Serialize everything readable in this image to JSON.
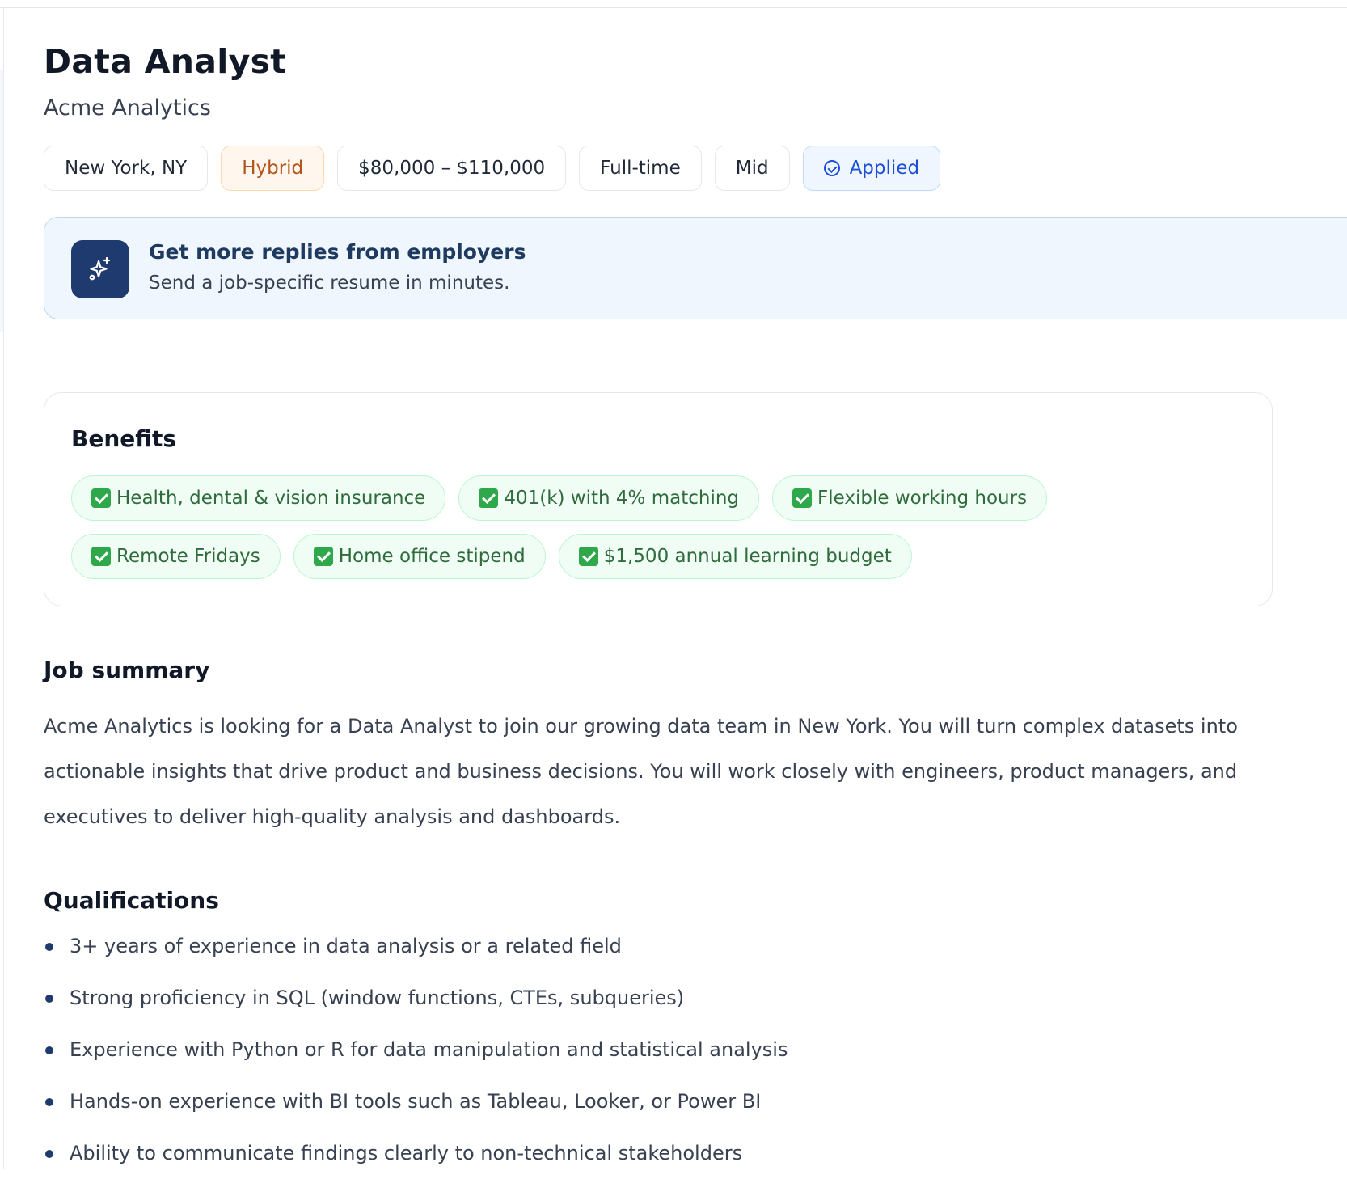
{
  "job": {
    "title": "Data Analyst",
    "company": "Acme Analytics"
  },
  "tags": {
    "location": "New York, NY",
    "work_mode": "Hybrid",
    "salary": "$80,000 – $110,000",
    "employment_type": "Full-time",
    "level": "Mid",
    "status": "Applied"
  },
  "promo": {
    "icon": "sparkles-icon",
    "title": "Get more replies from employers",
    "subtitle": "Send a job-specific resume in minutes."
  },
  "benefits": {
    "title": "Benefits",
    "items": [
      "Health, dental & vision insurance",
      "401(k) with 4% matching",
      "Flexible working hours",
      "Remote Fridays",
      "Home office stipend",
      "$1,500 annual learning budget"
    ]
  },
  "summary": {
    "title": "Job summary",
    "text": "Acme Analytics is looking for a Data Analyst to join our growing data team in New York. You will turn complex datasets into actionable insights that drive product and business decisions. You will work closely with engineers, product managers, and executives to deliver high-quality analysis and dashboards."
  },
  "qualifications": {
    "title": "Qualifications",
    "items": [
      "3+ years of experience in data analysis or a related field",
      "Strong proficiency in SQL (window functions, CTEs, subqueries)",
      "Experience with Python or R for data manipulation and statistical analysis",
      "Hands-on experience with BI tools such as Tableau, Looker, or Power BI",
      "Ability to communicate findings clearly to non-technical stakeholders"
    ]
  },
  "colors": {
    "accent_navy": "#1e3a6e",
    "hybrid_orange": "#b4531a",
    "applied_blue": "#1d4ed8",
    "benefit_green": "#2f6b3d"
  }
}
